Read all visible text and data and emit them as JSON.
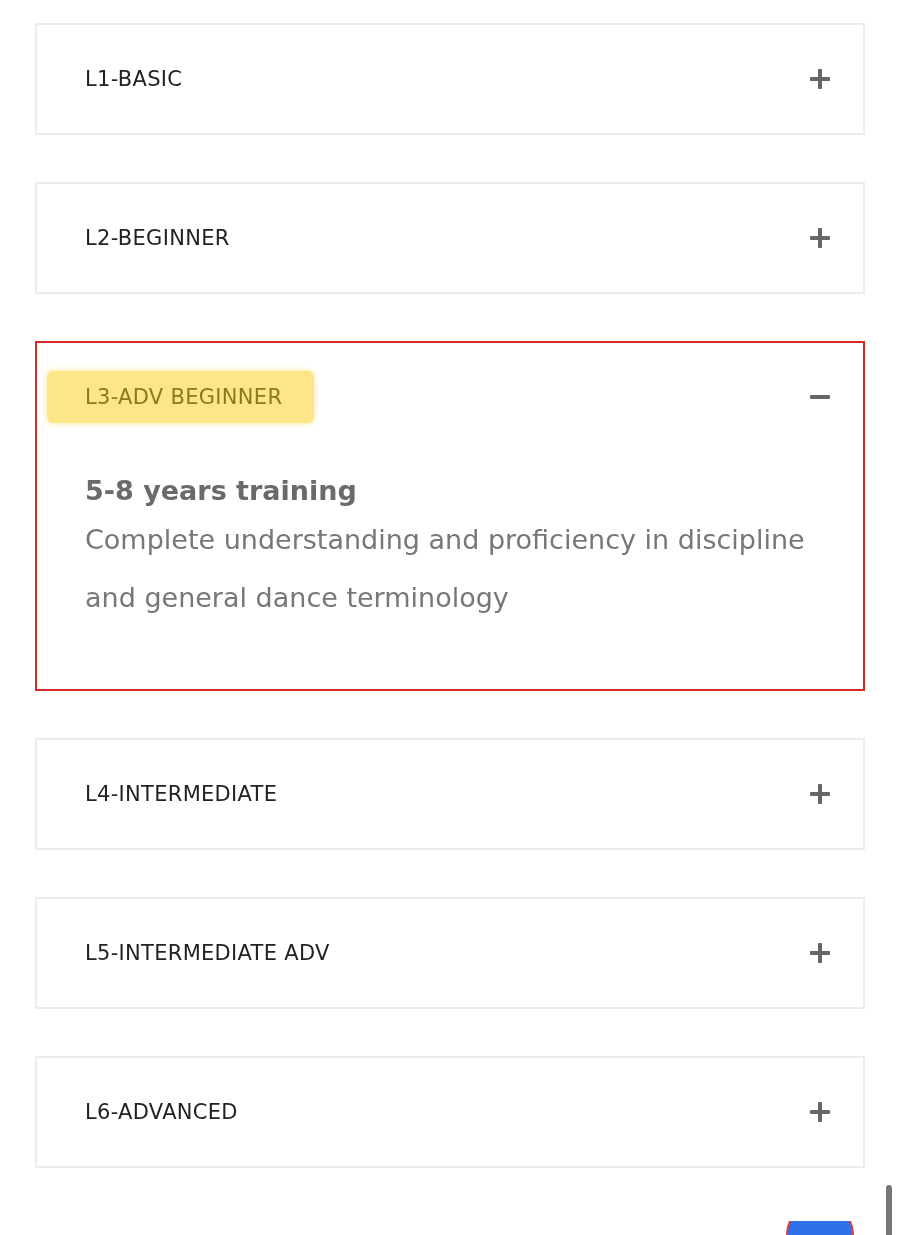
{
  "accordion": [
    {
      "title": "L1-BASIC",
      "expanded": false,
      "highlighted": false
    },
    {
      "title": "L2-BEGINNER",
      "expanded": false,
      "highlighted": false
    },
    {
      "title": "L3-ADV BEGINNER",
      "expanded": true,
      "highlighted": true,
      "heading": "5-8 years training",
      "text": "Complete understanding and proficiency in discipline and general dance terminology"
    },
    {
      "title": "L4-INTERMEDIATE",
      "expanded": false,
      "highlighted": false
    },
    {
      "title": "L5-INTERMEDIATE ADV",
      "expanded": false,
      "highlighted": false
    },
    {
      "title": "L6-ADVANCED",
      "expanded": false,
      "highlighted": false
    }
  ]
}
